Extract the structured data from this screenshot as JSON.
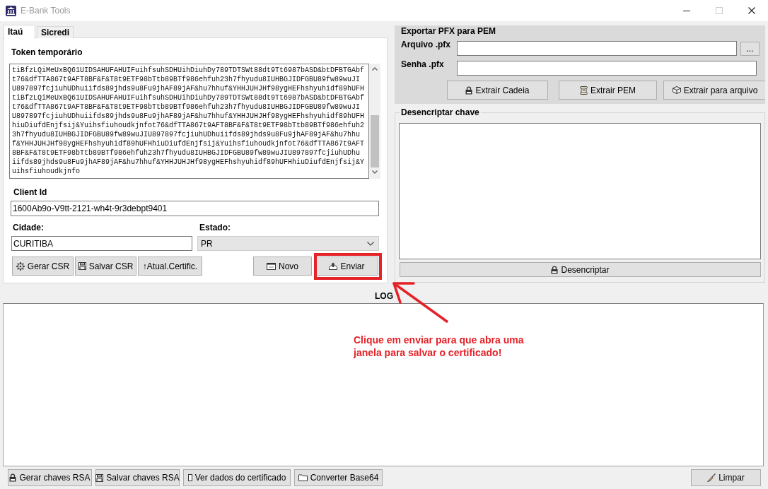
{
  "window": {
    "title": "E-Bank Tools",
    "controls": [
      {
        "kind": "minimize",
        "disabled": false
      },
      {
        "kind": "maximize",
        "disabled": true
      },
      {
        "kind": "close",
        "disabled": false
      }
    ]
  },
  "tabs": [
    {
      "label": "Itaú",
      "selected": true
    },
    {
      "label": "Sicredi",
      "selected": false
    }
  ],
  "itau_page": {
    "token": {
      "label": "Token temporário",
      "lines": [
        "tiBfzLQiMeUxBQ61UIDSAHUFAHUIFuihfsuhSDHUihDiuhDy789TDTSWt88dt9Tt6987bASD&btDFBTGAbf",
        "t76&dfTTA867t9AFT8BF&F&T8t9ETF98bTtb89BTf986ehfuh23h7fhyudu8IUHBGJIDFGBU89fw89wuJI",
        "U897897fcjiuhUDhuiifds89jhds9u8Fu9jhAF89jAF&hu7hhuf&YHHJUHJHf98ygHEFhshyuhidf89hUFH",
        "tiBfzLQiMeUxBQ61UIDSAHUFAHUIFuihfsuhSDHUihDiuhDy789TDTSWt88dt9Tt6987bASD&btDFBTGAbf",
        "t76&dfTTA867t9AFT8BF&F&T8t9ETF98bTtb89BTf986ehfuh23h7fhyudu8IUHBGJIDFGBU89fw89wuJI",
        "U897897fcjiuhUDhuiifds89jhds9u8Fu9jhAF89jAF&hu7hhuf&YHHJUHJHf98ygHEFhshyuhidf89hUFH",
        "hiuDiufdEnjfsij&Yuihsfiuhoudkjnfot76&dfTTA867t9AFT8BF&F&T8t9ETF98bTtb89BTf986ehfuh2",
        "3h7fhyudu8IUHBGJIDFGBU89fw89wuJIU897897fcjiuhUDhuiifds89jhds9u8Fu9jhAF89jAF&hu7hhu",
        "f&YHHJUHJHf98ygHEFhshyuhidf89hUFHhiuDiufdEnjfsij&Yuihsfiuhoudkjnfot76&dfTTA867t9AFT",
        "8BF&F&T8t9ETF98bTtb89BTf986ehfuh23h7fhyudu8IUHBGJIDFGBU89fw89wuJIU897897fcjiuhUDhu",
        "iifds89jhds9u8Fu9jhAF89jAF&hu7hhuf&YHHJUHJHf98ygHEFhshyuhidf89hUFHhiuDiufdEnjfsij&Y",
        "uihsfiuhoudkjnfo"
      ]
    },
    "client_id": {
      "label": "Client Id",
      "value": "1600Ab9o-V9tt-2121-wh4t-9r3debpt9401"
    },
    "cidade": {
      "label": "Cidade:",
      "value": "CURITIBA"
    },
    "estado": {
      "label": "Estado:",
      "value": "PR"
    },
    "csr_buttons": [
      "Gerar CSR",
      "Salvar CSR",
      "↑Atual.Certific."
    ],
    "action_buttons": [
      {
        "label": "Novo",
        "highlighted": false
      },
      {
        "label": "Enviar",
        "highlighted": true
      }
    ]
  },
  "export_pfx": {
    "title": "Exportar PFX para PEM",
    "file_label": "Arquivo .pfx",
    "browse_button": "...",
    "password_label": "Senha .pfx",
    "buttons": [
      "Extrair Cadeia",
      "Extrair PEM",
      "Extrair para arquivo"
    ]
  },
  "decrypt": {
    "title": "Desencriptar chave",
    "button": "Desencriptar"
  },
  "log": {
    "title": "LOG"
  },
  "footer": {
    "buttons": [
      "Gerar chaves RSA",
      "Salvar chaves RSA",
      "Ver dados do certificado",
      "Converter Base64"
    ],
    "clear_button": "Limpar"
  },
  "annotation": {
    "text": "Clique em enviar para que abra uma janela para salvar o certificado!"
  }
}
